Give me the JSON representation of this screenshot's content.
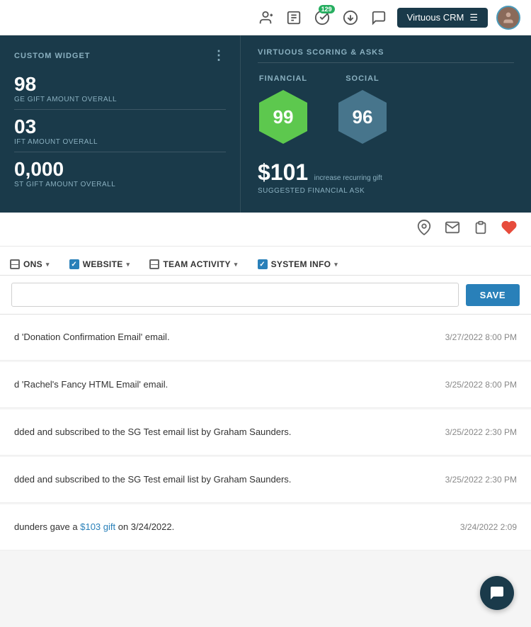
{
  "nav": {
    "brand": "Virtuous CRM",
    "menu_icon": "☰",
    "badge_count": "129",
    "avatar_label": "User Avatar"
  },
  "custom_widget": {
    "title": "CUSTOM WIDGET",
    "dots": "⋮",
    "stats": [
      {
        "number": "98",
        "label": "GE GIFT AMOUNT OVERALL"
      },
      {
        "number": "03",
        "label": "IFT AMOUNT OVERALL"
      },
      {
        "number": "0,000",
        "label": "ST GIFT AMOUNT OVERALL"
      }
    ]
  },
  "virtuous_scoring": {
    "title": "VIRTUOUS SCORING & ASKS",
    "financial": {
      "label": "FINANCIAL",
      "score": "99",
      "color": "#5dc84e"
    },
    "social": {
      "label": "SOCIAL",
      "score": "96",
      "color": "#5b8fa8"
    },
    "ask": {
      "amount": "$101",
      "sub": "increase recurring gift",
      "label": "SUGGESTED FINANCIAL ASK"
    }
  },
  "icon_bar": {
    "icons": [
      "location",
      "email",
      "clipboard",
      "heart"
    ]
  },
  "filter_bar": {
    "items": [
      {
        "id": "ons",
        "label": "ONS",
        "checked": "partial",
        "has_chevron": true
      },
      {
        "id": "website",
        "label": "WEBSITE",
        "checked": true,
        "has_chevron": true
      },
      {
        "id": "team_activity",
        "label": "TEAM ACTIVITY",
        "checked": "partial",
        "has_chevron": true
      },
      {
        "id": "system_info",
        "label": "SYSTEM INFO",
        "checked": true,
        "has_chevron": true
      }
    ]
  },
  "save_button": "SAVE",
  "activities": [
    {
      "text": "d 'Donation Confirmation Email' email.",
      "date": "3/27/2022 8:00 PM",
      "link": null
    },
    {
      "text": "d 'Rachel's Fancy HTML Email' email.",
      "date": "3/25/2022 8:00 PM",
      "link": null
    },
    {
      "text": "dded and subscribed to the SG Test email list by Graham Saunders.",
      "date": "3/25/2022 2:30 PM",
      "link": null
    },
    {
      "text": "dded and subscribed to the SG Test email list by Graham Saunders.",
      "date": "3/25/2022 2:30 PM",
      "link": null
    },
    {
      "text_before": "dunders gave a ",
      "link_text": "$103 gift",
      "text_after": " on 3/24/2022.",
      "date": "3/24/2022 2:09",
      "has_link": true
    }
  ],
  "chat_icon": "💬"
}
